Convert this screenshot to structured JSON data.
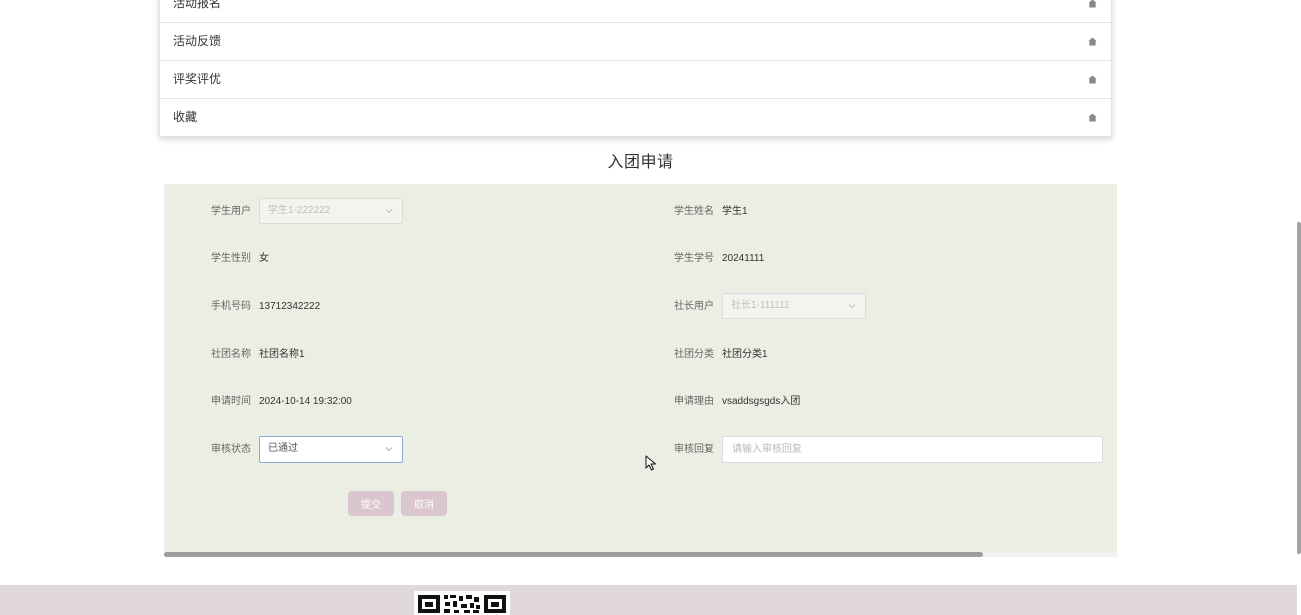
{
  "menu": {
    "items": [
      {
        "label": "活动报名",
        "icon": "home-icon"
      },
      {
        "label": "活动反馈",
        "icon": "home-icon"
      },
      {
        "label": "评奖评优",
        "icon": "home-icon"
      },
      {
        "label": "收藏",
        "icon": "home-icon"
      }
    ]
  },
  "form": {
    "title": "入团申请",
    "student_user": {
      "label": "学生用户",
      "value": "学生1-222222"
    },
    "student_name": {
      "label": "学生姓名",
      "value": "学生1"
    },
    "student_gender": {
      "label": "学生性别",
      "value": "女"
    },
    "student_id": {
      "label": "学生学号",
      "value": "20241111"
    },
    "phone": {
      "label": "手机号码",
      "value": "13712342222"
    },
    "leader_user": {
      "label": "社长用户",
      "value": "社长1-111111"
    },
    "club_name": {
      "label": "社团名称",
      "value": "社团名称1"
    },
    "club_category": {
      "label": "社团分类",
      "value": "社团分类1"
    },
    "apply_time": {
      "label": "申请时间",
      "value": "2024-10-14 19:32:00"
    },
    "apply_reason": {
      "label": "申请理由",
      "value": "vsaddsgsgds入团"
    },
    "review_status": {
      "label": "审核状态",
      "value": "已通过"
    },
    "review_reply": {
      "label": "审核回复",
      "value": "",
      "placeholder": "请输入审核回复"
    },
    "submit_label": "提交",
    "cancel_label": "取消"
  },
  "colors": {
    "panel_bg": "#ebeee3",
    "button_bg": "#dac6ce",
    "footer_bg": "#e0d8dc"
  },
  "icons": {
    "select_arrow": "chevron-down-icon",
    "footer_image": "qr-code-icon",
    "cursor": "mouse-cursor-icon"
  }
}
